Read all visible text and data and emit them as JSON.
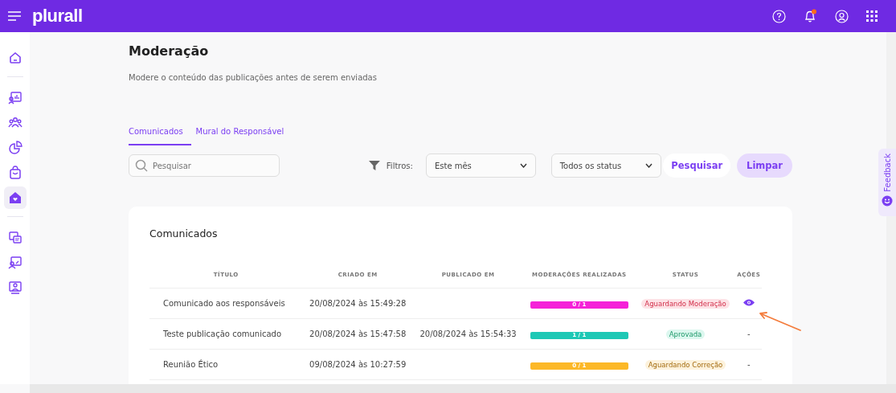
{
  "topbar": {
    "logo": "plurall",
    "notification_dot": true
  },
  "sidebar": {
    "groups": [
      [
        {
          "selected": false
        }
      ],
      [
        {
          "selected": false
        },
        {
          "selected": false
        },
        {
          "selected": false
        },
        {
          "selected": false
        },
        {
          "selected": true
        }
      ],
      [
        {
          "selected": false
        },
        {
          "selected": false
        },
        {
          "selected": false
        }
      ]
    ]
  },
  "page": {
    "title": "Moderação",
    "subtitle": "Modere o conteúdo das publicações antes de serem enviadas"
  },
  "tabs": [
    {
      "label": "Comunicados",
      "selected": true
    },
    {
      "label": "Mural do Responsável",
      "selected": false
    }
  ],
  "search": {
    "placeholder": "Pesquisar"
  },
  "filters": {
    "label": "Filtros:",
    "period": "Este mês",
    "status": "Todos os status",
    "search_button": "Pesquisar",
    "clear_button": "Limpar"
  },
  "feedback": {
    "label": "Feedback"
  },
  "table": {
    "title": "Comunicados",
    "columns": [
      "TÍTULO",
      "CRIADO EM",
      "PUBLICADO EM",
      "MODERAÇÕES REALIZADAS",
      "STATUS",
      "AÇÕES"
    ],
    "rows": [
      {
        "title": "Comunicado aos responsáveis",
        "created": "20/08/2024 às 15:49:28",
        "moderations": "0 / 1",
        "color": "#f522d8",
        "status": {
          "text": "Aguardando Moderação",
          "kind": "pending"
        },
        "action": {
          "kind": "view"
        }
      },
      {
        "title": "Teste publicação comunicado",
        "created": "20/08/2024 às 15:47:58",
        "published": "20/08/2024 às 15:54:33",
        "moderations": "1 / 1",
        "color": "#1ec8b5",
        "status": {
          "text": "Aprovada",
          "kind": "approved"
        },
        "action": {
          "kind": "text",
          "text": "-"
        }
      },
      {
        "title": "Reunião Ético",
        "created": "09/08/2024 às 10:27:59",
        "moderations": "0 / 1",
        "color": "#fcb827",
        "status": {
          "text": "Aguardando Correção",
          "kind": "correction"
        },
        "action": {
          "kind": "text",
          "text": "-"
        }
      }
    ]
  }
}
